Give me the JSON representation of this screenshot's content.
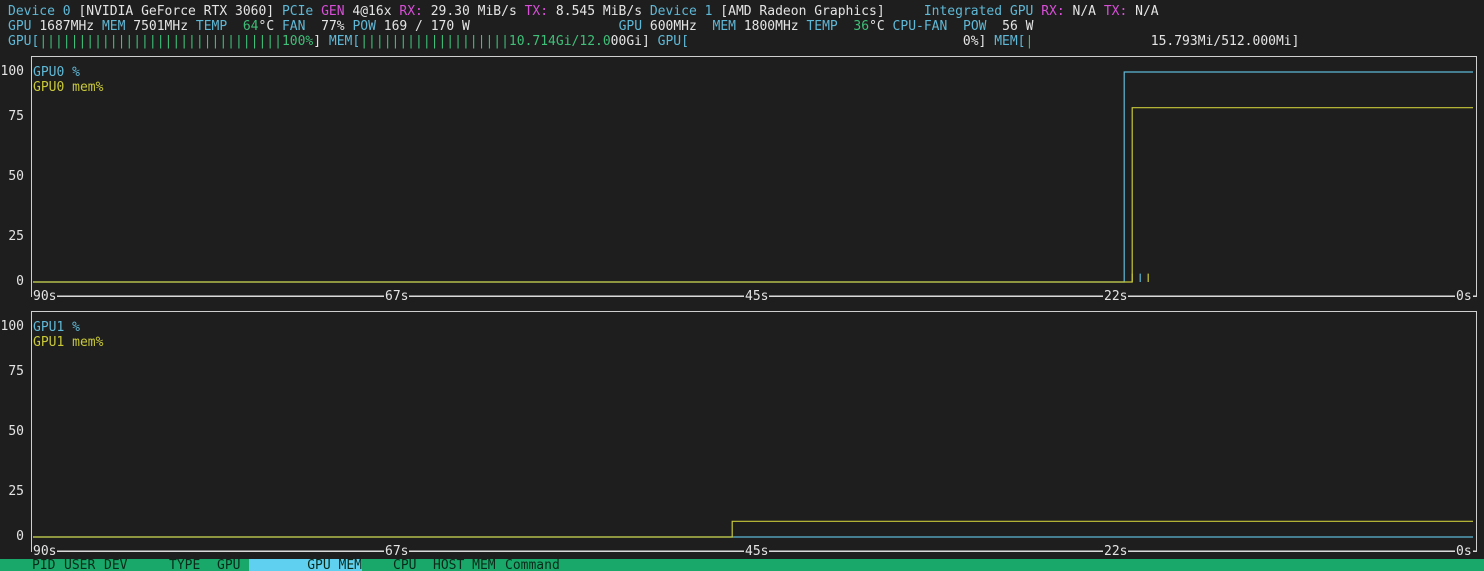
{
  "header": {
    "line1": {
      "dev0_label": "Device 0",
      "dev0_name": "[NVIDIA GeForce RTX 3060]",
      "pcie_label": "PCIe",
      "gen_label": "GEN",
      "gen_value": "4@16x",
      "rx_label": "RX:",
      "rx_value": "29.30 MiB/s",
      "tx_label": "TX:",
      "tx_value": "8.545 MiB/s",
      "dev1_label": "Device 1",
      "dev1_name": "[AMD Radeon Graphics]",
      "integrated_label": "Integrated GPU",
      "rx1_label": "RX:",
      "rx1_value": "N/A",
      "tx1_label": "TX:",
      "tx1_value": "N/A"
    },
    "line2": {
      "gpu_label": "GPU",
      "gpu_clock": "1687MHz",
      "mem_label": "MEM",
      "mem_clock": "7501MHz",
      "temp_label": "TEMP",
      "temp_value": "64",
      "temp_unit": "°C",
      "fan_label": "FAN",
      "fan_value": "77%",
      "pow_label": "POW",
      "pow_value": "169 / 170 W",
      "gpu1_label": "GPU",
      "gpu1_clock": "600MHz",
      "mem1_label": "MEM",
      "mem1_clock": "1800MHz",
      "temp1_label": "TEMP",
      "temp1_value": "36",
      "temp1_unit": "°C",
      "cpufan_label": "CPU-FAN",
      "pow1_label": "POW",
      "pow1_value": "56 W"
    },
    "line3": {
      "gpu_bar_label": "GPU[",
      "gpu_bar_fill": "|||||||||||||||||||||||||||||||100%",
      "gpu_bar_end": "]",
      "mem_bar_label": "MEM[",
      "mem_bar_fill": "|||||||||||||||||||10.714Gi/12.0",
      "mem_bar_rest": "00Gi]",
      "gpu1_bar_label": "GPU[",
      "gpu1_bar_value": "0%]",
      "mem1_bar_label": "MEM[",
      "mem1_bar_fill": "|",
      "mem1_bar_value": "15.793Mi/512.000Mi]"
    }
  },
  "colors": {
    "cyan": "#5fb8d6",
    "yellow": "#c8c83a",
    "green": "#3fbf78",
    "magenta": "#d64fd6",
    "footer_green": "#1aa86a",
    "footer_active": "#5fd0f0"
  },
  "chart_data": [
    {
      "type": "line",
      "title": "",
      "y_ticks": [
        "100",
        "75",
        "50",
        "25",
        "0"
      ],
      "x_ticks": [
        "90s",
        "67s",
        "45s",
        "22s",
        "0s"
      ],
      "ylim": [
        0,
        100
      ],
      "xlim": [
        -90,
        0
      ],
      "series": [
        {
          "name": "GPU0 %",
          "color": "#5fb8d6",
          "x": [
            -90,
            -21.8,
            -21.8,
            -21.1,
            -21.1,
            -20.9,
            -20.9,
            -20.6,
            -20.6,
            -20.2,
            -20.2,
            0
          ],
          "y": [
            0,
            0,
            100,
            100,
            100,
            100,
            100,
            100,
            100,
            100,
            100,
            100
          ]
        },
        {
          "name": "GPU0 mem%",
          "color": "#c8c83a",
          "x": [
            -90,
            -21.3,
            -21.3,
            0
          ],
          "y": [
            0,
            0,
            83,
            83
          ]
        }
      ],
      "spikes": [
        {
          "x": -21.3,
          "y": 4,
          "color": "#c8c83a"
        },
        {
          "x": -20.8,
          "y": 4,
          "color": "#5fb8d6"
        },
        {
          "x": -20.3,
          "y": 4,
          "color": "#c8c83a"
        }
      ]
    },
    {
      "type": "line",
      "title": "",
      "y_ticks": [
        "100",
        "75",
        "50",
        "25",
        "0"
      ],
      "x_ticks": [
        "90s",
        "67s",
        "45s",
        "22s",
        "0s"
      ],
      "ylim": [
        0,
        100
      ],
      "xlim": [
        -90,
        0
      ],
      "series": [
        {
          "name": "GPU1 %",
          "color": "#5fb8d6",
          "x": [
            -90,
            0
          ],
          "y": [
            0,
            0
          ]
        },
        {
          "name": "GPU1 mem%",
          "color": "#c8c83a",
          "x": [
            -90,
            -46.3,
            -46.3,
            0
          ],
          "y": [
            0,
            0,
            7.5,
            7.5
          ]
        }
      ]
    }
  ],
  "panels": [
    {
      "legend_a": "GPU0 %",
      "legend_b": "GPU0 mem%"
    },
    {
      "legend_a": "GPU1 %",
      "legend_b": "GPU1 mem%"
    }
  ],
  "footer": {
    "columns": [
      "PID",
      "USER",
      "DEV",
      "TYPE",
      "GPU",
      "GPU MEM",
      "CPU",
      "HOST MEM",
      "Command"
    ],
    "active": "GPU MEM"
  }
}
